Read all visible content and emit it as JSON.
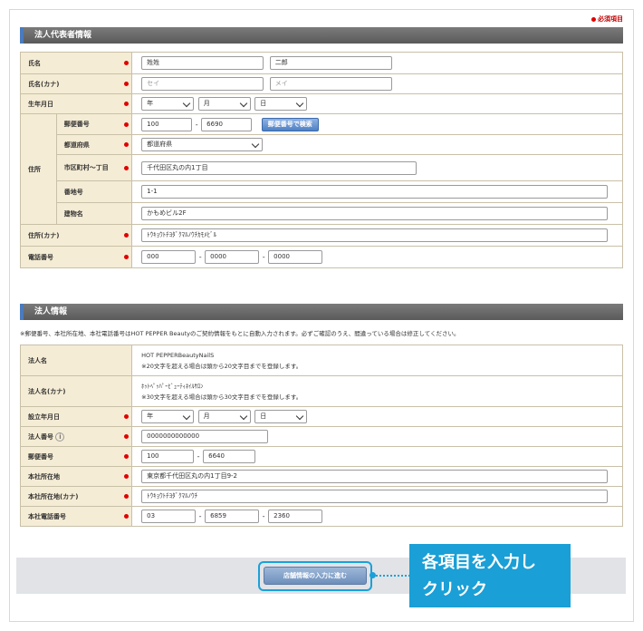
{
  "required_note": "必須項目",
  "rep": {
    "title": "法人代表者情報",
    "name_label": "氏名",
    "name_last_value": "姓姓",
    "name_first_value": "二郎",
    "kana_label": "氏名(カナ)",
    "kana_last_ph": "セイ",
    "kana_first_ph": "メイ",
    "birth_label": "生年月日",
    "birth_year": "年",
    "birth_month": "月",
    "birth_day": "日",
    "address_group_label": "住所",
    "zip_label": "郵便番号",
    "zip1": "100",
    "zip2": "6690",
    "zip_button": "郵便番号で検索",
    "pref_label": "都道府県",
    "pref_value": "都道府県",
    "city_label": "市区町村〜丁目",
    "city_value": "千代田区丸の内1丁目",
    "street_label": "番地号",
    "street_value": "1-1",
    "building_label": "建物名",
    "building_value": "かもめビル2F",
    "addr_kana_label": "住所(カナ)",
    "addr_kana_value": "ﾄｳｷｮｳﾄﾁﾖﾀﾞｸﾏﾙﾉｳﾁｶﾓﾒﾋﾞﾙ",
    "phone_label": "電話番号",
    "phone1": "000",
    "phone2": "0000",
    "phone3": "0000"
  },
  "corp": {
    "title": "法人情報",
    "notice": "※郵便番号、本社所在地、本社電話番号はHOT PEPPER Beautyのご契約情報をもとに自動入力されます。必ずご確認のうえ、間違っている場合は修正してください。",
    "name_label": "法人名",
    "name_value": "HOT PEPPERBeautyNailS",
    "name_note": "※20文字を超える場合は頭から20文字目までを登録します。",
    "kana_label": "法人名(カナ)",
    "kana_value": "ﾎｯﾄﾍﾟｯﾊﾟｰﾋﾞｭｰﾃｨﾈｲﾙｻﾛﾝ",
    "kana_note": "※30文字を超える場合は頭から30文字目までを登録します。",
    "est_label": "設立年月日",
    "est_year": "年",
    "est_month": "月",
    "est_day": "日",
    "num_label": "法人番号",
    "num_value": "0000000000000",
    "zip_label": "郵便番号",
    "zip1": "100",
    "zip2": "6640",
    "hq_label": "本社所在地",
    "hq_value": "東京都千代田区丸の内1丁目9-2",
    "hq_kana_label": "本社所在地(カナ)",
    "hq_kana_value": "ﾄｳｷｮｳﾄﾁﾖﾀﾞｸﾏﾙﾉｳﾁ",
    "phone_label": "本社電話番号",
    "phone1": "03",
    "phone2": "6859",
    "phone3": "2360"
  },
  "submit_label": "店舗情報の入力に進む",
  "callout_line1": "各項目を入力し",
  "callout_line2": "クリック"
}
